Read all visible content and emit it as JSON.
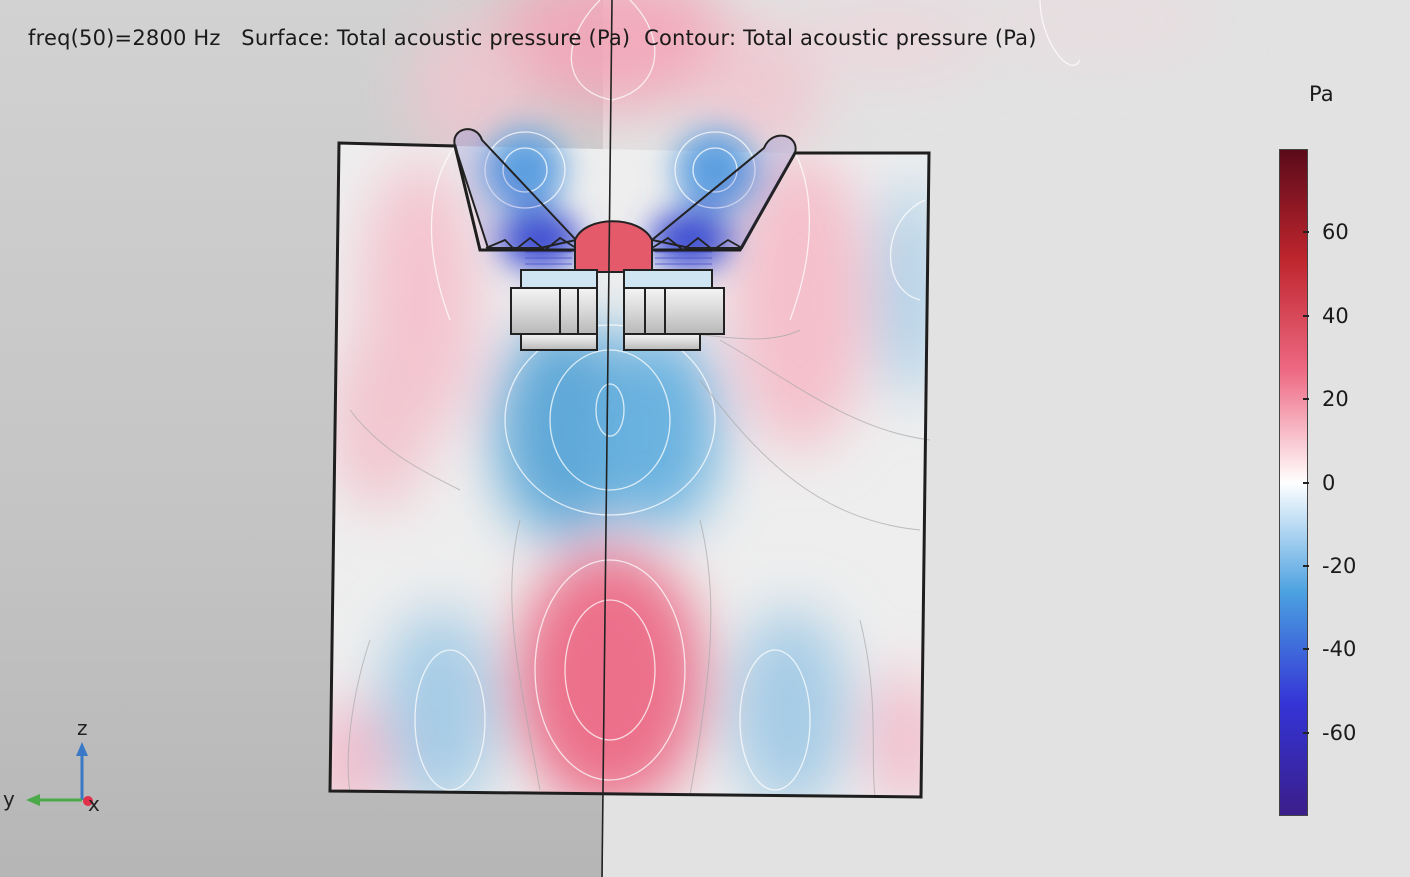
{
  "title": {
    "freq": "freq(50)=2800 Hz",
    "surface": "Surface: Total acoustic pressure (Pa)",
    "contour": "Contour: Total acoustic pressure (Pa)"
  },
  "colorbar": {
    "unit": "Pa",
    "range": [
      -80,
      80
    ],
    "ticks": [
      "60",
      "40",
      "20",
      "0",
      "-20",
      "-40",
      "-60"
    ],
    "tick_values": [
      60,
      40,
      20,
      0,
      -20,
      -40,
      -60
    ],
    "colors": [
      "#5b0a1a",
      "#c0262e",
      "#ee6a84",
      "#ffffff",
      "#4aa0e0",
      "#3434d6",
      "#3a1e8a"
    ]
  },
  "axis_triad": {
    "z": "z",
    "y": "y",
    "x": "x"
  },
  "chart_data": {
    "type": "heatmap",
    "title": "freq(50)=2800 Hz  Surface: Total acoustic pressure (Pa)  Contour: Total acoustic pressure (Pa)",
    "quantity": "Total acoustic pressure",
    "unit": "Pa",
    "frequency": "2800 Hz",
    "color_range": [
      -80,
      80
    ],
    "colorbar_ticks": [
      60,
      40,
      20,
      0,
      -20,
      -40,
      -60
    ]
  }
}
